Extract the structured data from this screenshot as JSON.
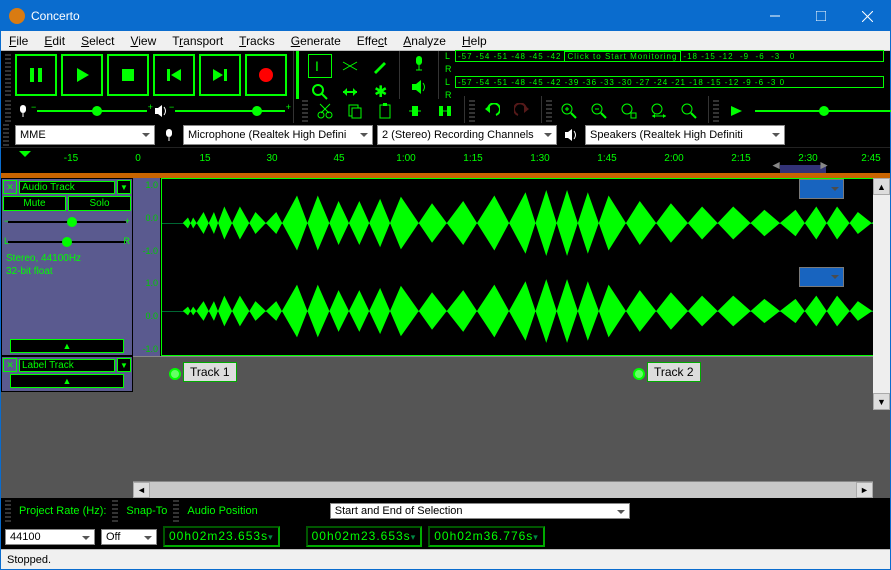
{
  "window": {
    "title": "Concerto"
  },
  "menu": [
    "File",
    "Edit",
    "Select",
    "View",
    "Transport",
    "Tracks",
    "Generate",
    "Effect",
    "Analyze",
    "Help"
  ],
  "meter_ticks": "-57 -54 -51 -48 -45 -42 -39 -36 -33 -30 -27 -24 -21 -18 -15 -12  -9  -6  -3   0",
  "monitor_hint": "Click to Start Monitoring",
  "device": {
    "host": "MME",
    "input": "Microphone (Realtek High Defini",
    "channels": "2 (Stereo) Recording Channels",
    "output": "Speakers (Realtek High Definiti"
  },
  "timeline": [
    "-15",
    "0",
    "15",
    "30",
    "45",
    "1:00",
    "1:15",
    "1:30",
    "1:45",
    "2:00",
    "2:15",
    "2:30",
    "2:45"
  ],
  "track1": {
    "name": "Audio Track",
    "mute": "Mute",
    "solo": "Solo",
    "info1": "Stereo, 44100Hz",
    "info2": "32-bit float",
    "ruler": [
      "1.0",
      "0.0",
      "-1.0",
      "1.0",
      "0.0",
      "-1.0"
    ]
  },
  "labeltrack": {
    "name": "Label Track"
  },
  "labels": {
    "l1": "Track 1",
    "l2": "Track 2"
  },
  "bottom": {
    "rate_label": "Project Rate (Hz):",
    "rate_value": "44100",
    "snap_label": "Snap-To",
    "snap_value": "Off",
    "pos_label": "Audio Position",
    "sel_label": "Start and End of Selection"
  },
  "timecode": {
    "pos": "00h02m23.653s",
    "start": "00h02m23.653s",
    "end": "00h02m36.776s"
  },
  "status": "Stopped."
}
